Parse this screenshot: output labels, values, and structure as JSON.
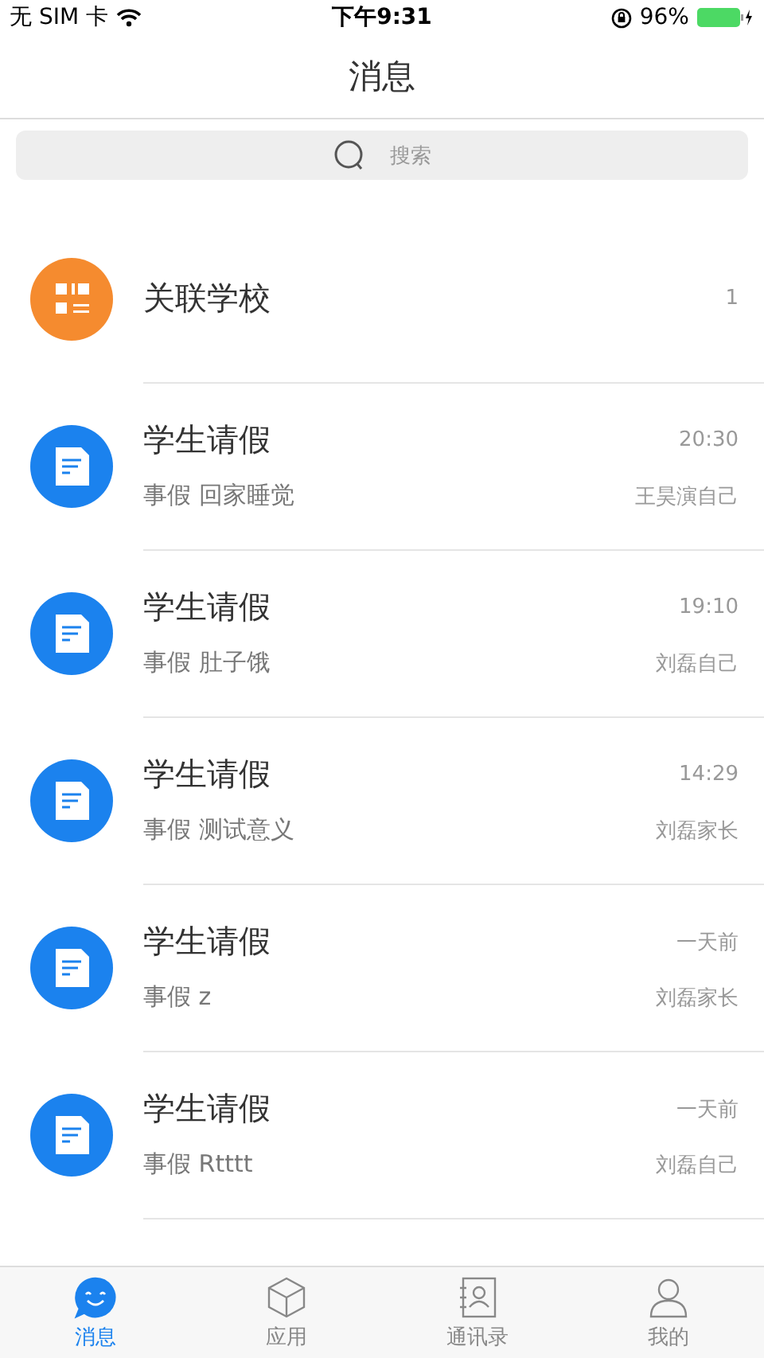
{
  "status_bar": {
    "carrier": "无 SIM 卡",
    "time": "下午9:31",
    "battery": "96%"
  },
  "nav": {
    "title": "消息"
  },
  "search": {
    "placeholder": "搜索"
  },
  "messages": [
    {
      "kind": "school",
      "title": "关联学校",
      "time": "1"
    },
    {
      "kind": "leave",
      "title": "学生请假",
      "time": "20:30",
      "subtitle": "事假 回家睡觉",
      "sender": "王昊演自己"
    },
    {
      "kind": "leave",
      "title": "学生请假",
      "time": "19:10",
      "subtitle": "事假 肚子饿",
      "sender": "刘磊自己"
    },
    {
      "kind": "leave",
      "title": "学生请假",
      "time": "14:29",
      "subtitle": "事假 测试意义",
      "sender": "刘磊家长"
    },
    {
      "kind": "leave",
      "title": "学生请假",
      "time": "一天前",
      "subtitle": "事假 z",
      "sender": "刘磊家长"
    },
    {
      "kind": "leave",
      "title": "学生请假",
      "time": "一天前",
      "subtitle": "事假 Rtttt",
      "sender": "刘磊自己"
    }
  ],
  "tabs": [
    {
      "kind": "chat",
      "label": "消息",
      "selected": true
    },
    {
      "kind": "box",
      "label": "应用",
      "selected": false
    },
    {
      "kind": "contacts",
      "label": "通讯录",
      "selected": false
    },
    {
      "kind": "person",
      "label": "我的",
      "selected": false
    }
  ]
}
